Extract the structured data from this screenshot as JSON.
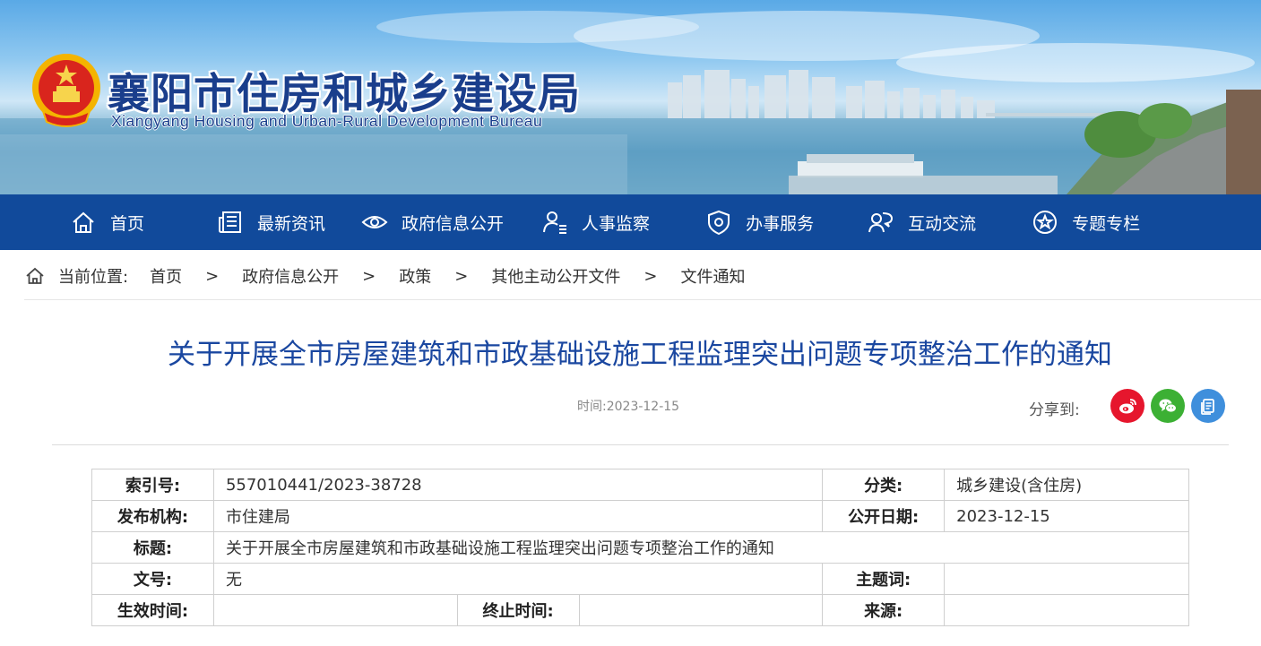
{
  "site": {
    "title_cn": "襄阳市住房和城乡建设局",
    "title_en": "Xiangyang Housing and Urban-Rural Development Bureau"
  },
  "nav": {
    "items": [
      {
        "label": "首页",
        "icon": "home-icon"
      },
      {
        "label": "最新资讯",
        "icon": "newspaper-icon"
      },
      {
        "label": "政府信息公开",
        "icon": "eye-icon"
      },
      {
        "label": "人事监察",
        "icon": "person-list-icon"
      },
      {
        "label": "办事服务",
        "icon": "shield-icon"
      },
      {
        "label": "互动交流",
        "icon": "people-chat-icon"
      },
      {
        "label": "专题专栏",
        "icon": "star-icon"
      }
    ]
  },
  "breadcrumb": {
    "label": "当前位置:",
    "separator": ">",
    "items": [
      "首页",
      "政府信息公开",
      "政策",
      "其他主动公开文件",
      "文件通知"
    ]
  },
  "article": {
    "title": "关于开展全市房屋建筑和市政基础设施工程监理突出问题专项整治工作的通知",
    "time_text": "时间:2023-12-15",
    "share_label": "分享到:"
  },
  "meta_table": {
    "index_label": "索引号:",
    "index_value": "557010441/2023-38728",
    "category_label": "分类:",
    "category_value": "城乡建设(含住房)",
    "publisher_label": "发布机构:",
    "publisher_value": "市住建局",
    "date_label": "公开日期:",
    "date_value": "2023-12-15",
    "title_label": "标题:",
    "title_value": "关于开展全市房屋建筑和市政基础设施工程监理突出问题专项整治工作的通知",
    "docno_label": "文号:",
    "docno_value": "无",
    "keywords_label": "主题词:",
    "keywords_value": "",
    "effective_label": "生效时间:",
    "effective_value": "",
    "end_label": "终止时间:",
    "end_value": "",
    "source_label": "来源:",
    "source_value": ""
  },
  "colors": {
    "nav_bg": "#114a9b",
    "title_blue": "#1a47a0",
    "weibo_red": "#e6162d",
    "wechat_green": "#3cb034",
    "share_blue": "#3f8fdc"
  }
}
